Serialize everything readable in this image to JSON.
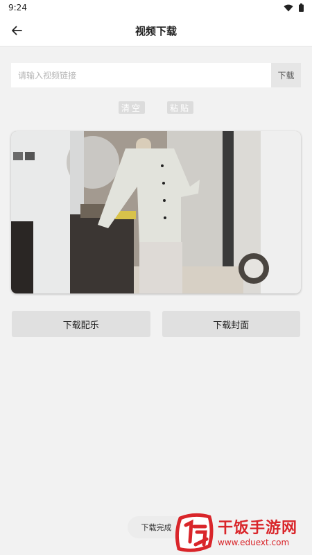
{
  "status_bar": {
    "time": "9:24"
  },
  "app_bar": {
    "title": "视频下载"
  },
  "url_input": {
    "placeholder": "请输入视频链接",
    "value": ""
  },
  "download_label": "下载",
  "chips": {
    "clear_label": "清空",
    "paste_label": "粘贴"
  },
  "buttons": {
    "download_music": "下载配乐",
    "download_cover": "下载封面"
  },
  "toast": {
    "message": "下载完成"
  },
  "watermark": {
    "brand": "干饭手游网",
    "url": "www.eduext.com"
  },
  "icons": {
    "back": "arrow-left-icon",
    "wifi": "wifi-icon",
    "battery": "battery-icon",
    "watermark_logo": "fan-logo-icon"
  },
  "colors": {
    "background": "#f2f2f2",
    "button_bg": "#e0e0e0",
    "watermark_red": "#d9252a"
  }
}
